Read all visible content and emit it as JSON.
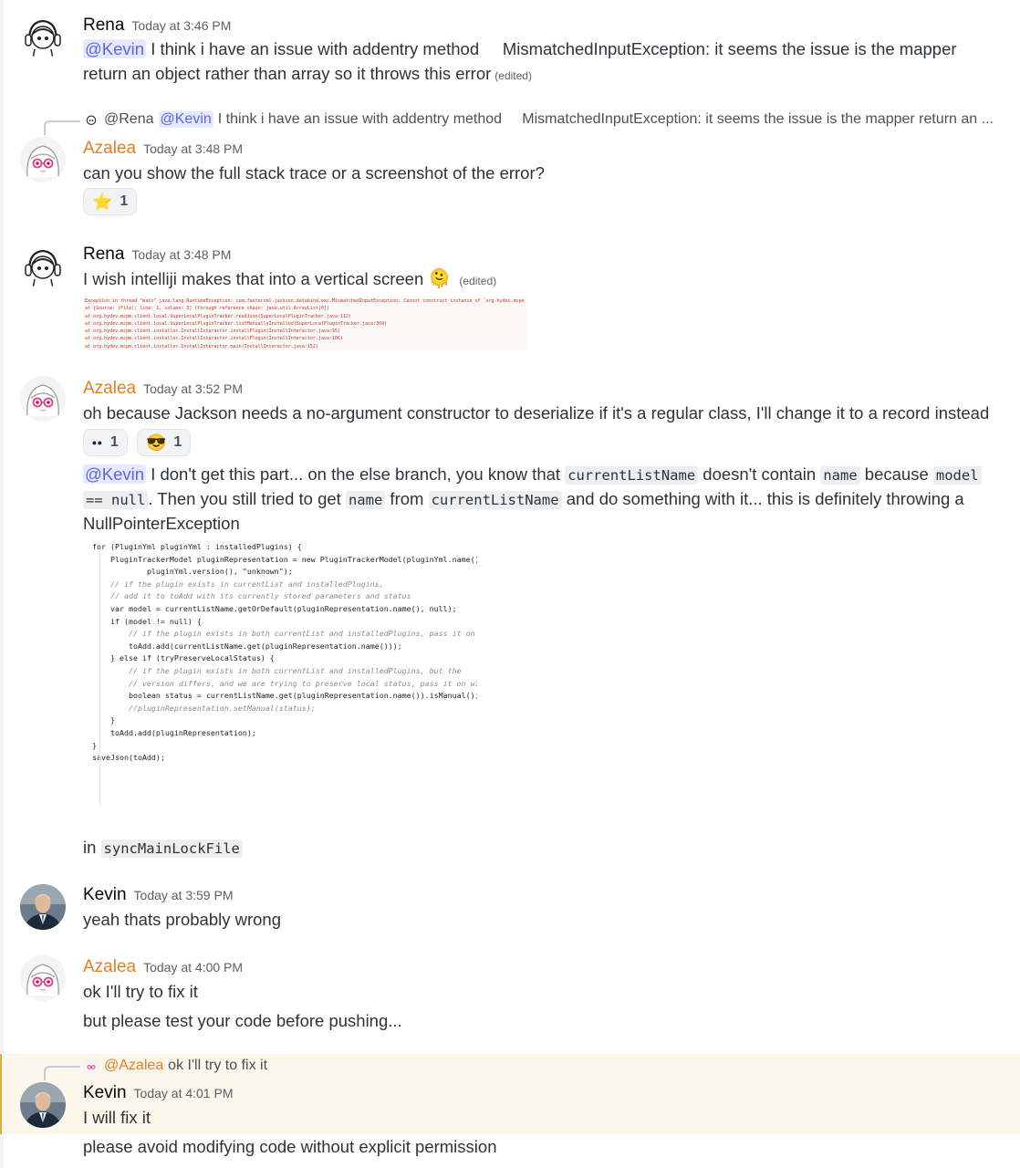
{
  "users": {
    "rena": "Rena",
    "azalea": "Azalea",
    "kevin": "Kevin"
  },
  "messages": [
    {
      "time": "Today at 3:46 PM",
      "mention": "@Kevin",
      "line1": " I think i have an issue with addentry method     MismatchedInputException: it seems the issue is the mapper",
      "line2": "return an object rather than array so it throws this error",
      "edited": "(edited)"
    },
    {
      "reply_author": "@Rena",
      "reply_mention": "@Kevin",
      "reply_text": "I think i have an issue with addentry method     MismatchedInputException: it seems the issue is the mapper return an ...",
      "time": "Today at 3:48 PM",
      "text": "can you show the full stack trace or a screenshot of the error?",
      "reaction_emoji": "⭐",
      "reaction_count": "1"
    },
    {
      "time": "Today at 3:48 PM",
      "text": "I wish intelliji makes that into a vertical screen",
      "emoji": "🫠",
      "edited": "(edited)",
      "stack_lines": [
        "Exception in thread \"main\" java.lang.RuntimeException: com.fasterxml.jackson.databind.exc.MismatchedInputException: Cannot construct instance of `org.hydev.mcpe",
        " at [Source: (File); line: 1, column: 3] (through reference chain: java.util.ArrayList[0])",
        "    at org.hydev.mcpm.client.local.SuperLocalPluginTracker.readJson(SuperLocalPluginTracker.java:112)",
        "    at org.hydev.mcpm.client.local.SuperLocalPluginTracker.listManuallyInstalled(SuperLocalPluginTracker.java:304)",
        "    at org.hydev.mcpm.client.installer.InstallInteractor.installPlugin(InstallInteractor.java:95)",
        "    at org.hydev.mcpm.client.installer.InstallInteractor.installPlugin(InstallInteractor.java:106)",
        "    at org.hydev.mcpm.client.installer.InstallInteractor.main(InstallInteractor.java:152)"
      ]
    },
    {
      "time": "Today at 3:52 PM",
      "text": "oh because Jackson needs a no-argument constructor to deserialize if it's a regular class, I'll change it to a record instead",
      "reactions": [
        {
          "emoji": "••",
          "count": "1"
        },
        {
          "emoji": "😎",
          "count": "1"
        }
      ],
      "p2": {
        "mention": "@Kevin",
        "a": " I don't get this part... on the else branch, you know that ",
        "c1": "currentListName",
        "b": " doesn't contain ",
        "c2": "name",
        "c": " because ",
        "c3": "model",
        "c4": "== null",
        "d": ". Then you still tried to get ",
        "c5": "name",
        "e": " from ",
        "c6": "currentListName",
        "f": " and do something with it... this is definitely throwing a",
        "g": "NullPointerException"
      },
      "code_lines": [
        "for (PluginYml pluginYml : installedPlugins) {",
        "    PluginTrackerModel pluginRepresentation = new PluginTrackerModel(pluginYml.name(), false,",
        "            pluginYml.version(), \"unknown\");",
        "",
        "    // if the plugin exists in currentList and installedPlugins,",
        "    // add it to toAdd with its currently stored parameters and status",
        "",
        "    var model = currentListName.getOrDefault(pluginRepresentation.name(), null);",
        "",
        "    if (model != null) {",
        "        // if the plugin exists in both currentList and installedPlugins, pass it on",
        "        toAdd.add(currentListName.get(pluginRepresentation.name()));",
        "    } else if (tryPreserveLocalStatus) {",
        "        // if the plugin exists in both currentList and installedPlugins, but the",
        "        // version differs, and we are trying to preserve local status, pass it on with the same status",
        "        boolean status = currentListName.get(pluginRepresentation.name()).isManual();",
        "        //pluginRepresentation.setManual(status);",
        "    }",
        "",
        "    toAdd.add(pluginRepresentation);",
        "}",
        "",
        "saveJson(toAdd);"
      ],
      "p3_a": "in ",
      "p3_code": "syncMainLockFile"
    },
    {
      "time": "Today at 3:59 PM",
      "text": "yeah thats probably wrong"
    },
    {
      "time": "Today at 4:00 PM",
      "text1": "ok I'll try to fix it",
      "text2": "but please test your code before pushing..."
    },
    {
      "reply_author": "@Azalea",
      "reply_text": "ok I'll try to fix it",
      "time": "Today at 4:01 PM",
      "text1": "I will fix it",
      "text2": "please avoid modifying code without explicit permission"
    }
  ],
  "icons": {
    "rena_avatar": "anime-girl-headphones-avatar",
    "azalea_avatar": "anime-girl-pink-glasses-avatar",
    "kevin_avatar": "man-in-suit-photo-avatar"
  },
  "colors": {
    "azalea_name": "#e67e22",
    "mention_bg": "#e6e8fd",
    "mention_fg": "#5865f2",
    "highlight_bg": "#fdf6ea"
  }
}
